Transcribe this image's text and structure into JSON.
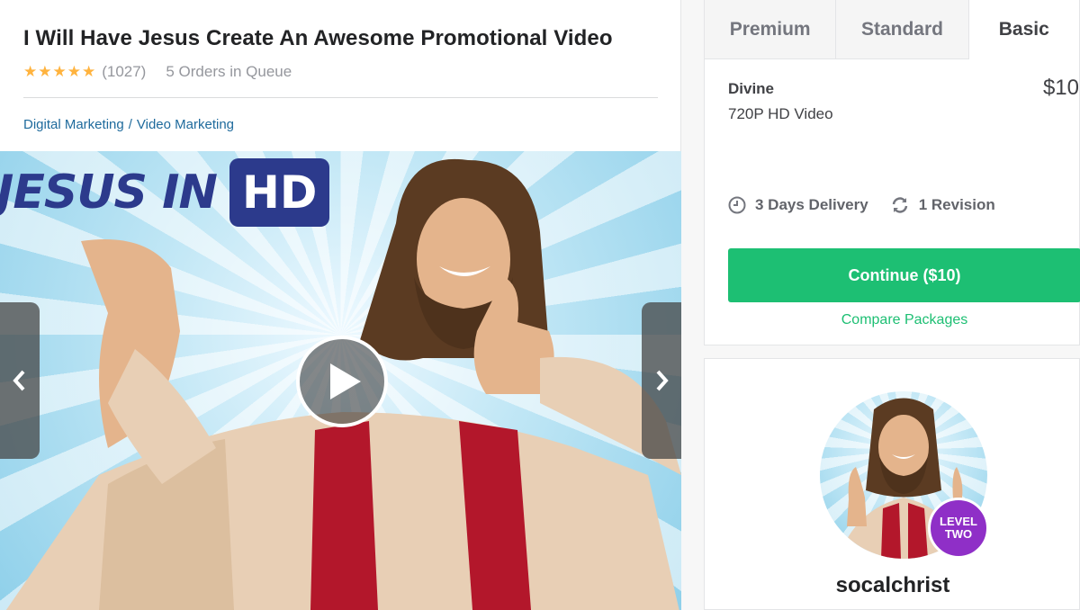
{
  "gig": {
    "title": "I Will Have Jesus Create An Awesome Promotional Video",
    "stars": "★★★★★",
    "rating": 5,
    "rating_count": "(1027)",
    "queue": "5 Orders in Queue"
  },
  "breadcrumb": {
    "category": "Digital Marketing",
    "separator": "/",
    "subcategory": "Video Marketing"
  },
  "media": {
    "banner_text": "JESUS IN",
    "banner_badge": "HD",
    "prev_icon": "chevron-left-icon",
    "next_icon": "chevron-right-icon",
    "play_icon": "play-icon"
  },
  "packages": {
    "tabs": [
      {
        "label": "Premium",
        "active": false
      },
      {
        "label": "Standard",
        "active": false
      },
      {
        "label": "Basic",
        "active": true
      }
    ],
    "name": "Divine",
    "price": "$10",
    "description": "720P HD Video",
    "delivery": "3 Days Delivery",
    "revisions": "1 Revision",
    "continue_label": "Continue ($10)",
    "compare_label": "Compare Packages"
  },
  "seller": {
    "username": "socalchrist",
    "level_line1": "LEVEL",
    "level_line2": "TWO"
  },
  "colors": {
    "accent_green": "#1dbf73",
    "star": "#ffb33e",
    "link": "#1e6a9c",
    "level_badge": "#8f2fc7",
    "banner_blue": "#2c3a8c"
  }
}
